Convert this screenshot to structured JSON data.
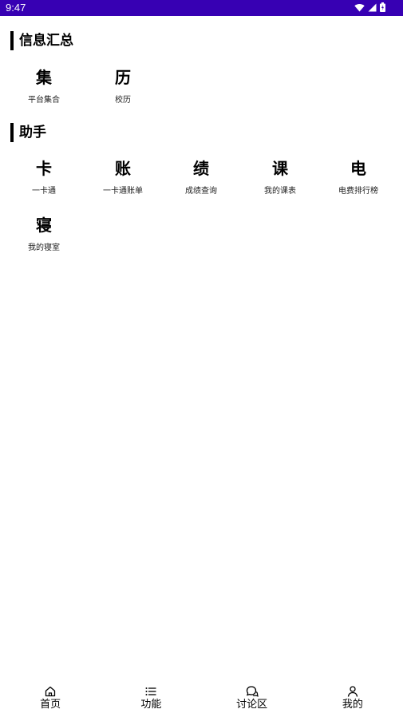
{
  "status_bar": {
    "time": "9:47",
    "color": "#3700b3",
    "icons": [
      "wifi-icon",
      "signal-icon",
      "battery-icon"
    ]
  },
  "sections": [
    {
      "title": "信息汇总",
      "items": [
        {
          "glyph": "集",
          "label": "平台集合"
        },
        {
          "glyph": "历",
          "label": "校历"
        }
      ]
    },
    {
      "title": "助手",
      "items": [
        {
          "glyph": "卡",
          "label": "一卡通"
        },
        {
          "glyph": "账",
          "label": "一卡通账单"
        },
        {
          "glyph": "绩",
          "label": "成绩查询"
        },
        {
          "glyph": "课",
          "label": "我的课表"
        },
        {
          "glyph": "电",
          "label": "电费排行榜"
        },
        {
          "glyph": "寝",
          "label": "我的寝室"
        }
      ]
    }
  ],
  "bottom_nav": {
    "items": [
      {
        "label": "首页",
        "icon": "home-icon"
      },
      {
        "label": "功能",
        "icon": "list-icon"
      },
      {
        "label": "讨论区",
        "icon": "chat-icon"
      },
      {
        "label": "我的",
        "icon": "person-icon"
      }
    ]
  }
}
